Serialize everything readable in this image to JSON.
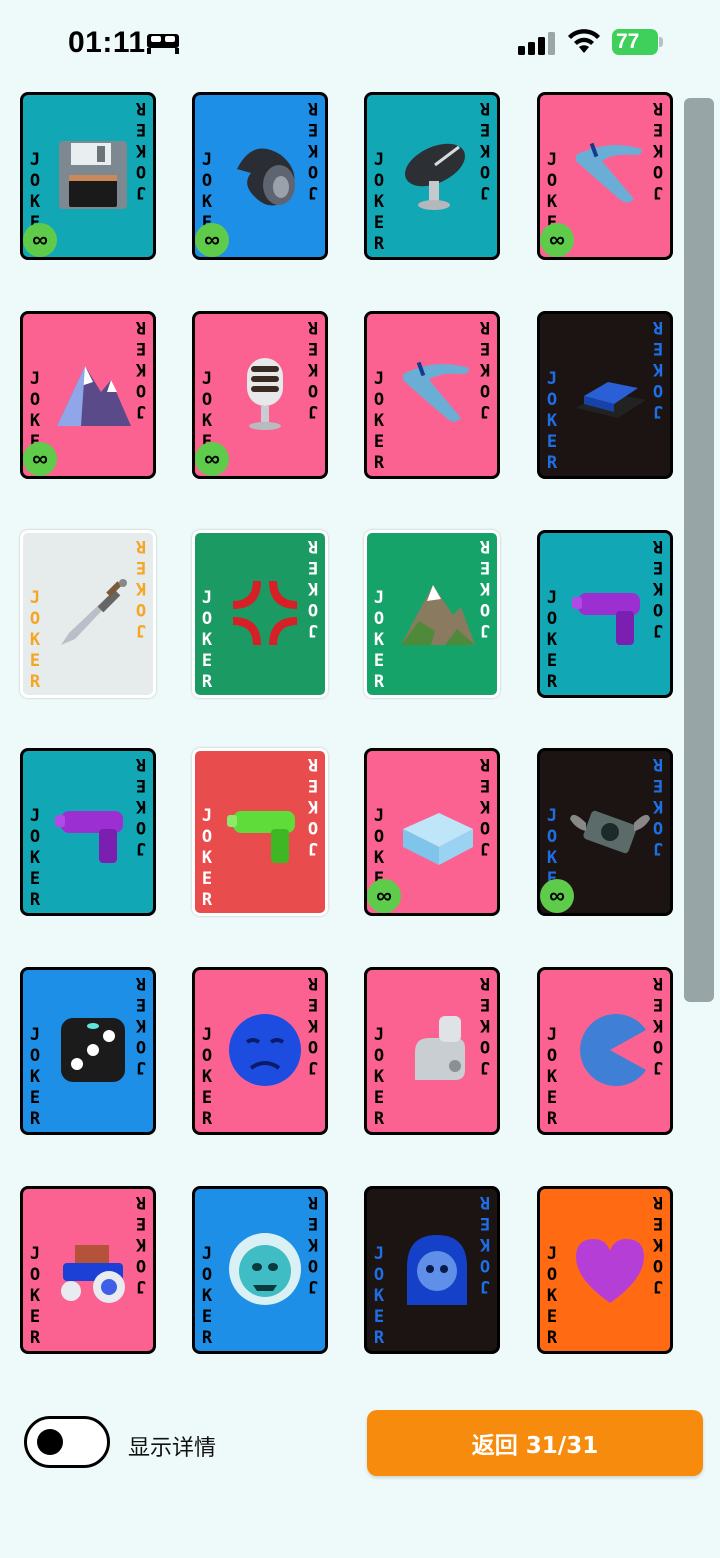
{
  "status_bar": {
    "time": "01:11",
    "battery_level": "77"
  },
  "joker_text": [
    "J",
    "O",
    "K",
    "E",
    "R"
  ],
  "infinity_symbol": "∞",
  "cards": [
    {
      "bg": "#12a7b5",
      "art": "floppy-disk",
      "letter_color": "#000",
      "infinite": true
    },
    {
      "bg": "#1e8fe6",
      "art": "spiral-shell",
      "letter_color": "#000",
      "infinite": true
    },
    {
      "bg": "#12a7b5",
      "art": "satellite-dish",
      "letter_color": "#000",
      "infinite": false
    },
    {
      "bg": "#fb6292",
      "art": "boomerang",
      "letter_color": "#000",
      "infinite": true
    },
    {
      "bg": "#fb6292",
      "art": "snow-mountain",
      "letter_color": "#000",
      "infinite": true
    },
    {
      "bg": "#fb6292",
      "art": "microphone",
      "letter_color": "#000",
      "infinite": true
    },
    {
      "bg": "#fb6292",
      "art": "boomerang",
      "letter_color": "#000",
      "infinite": false
    },
    {
      "bg": "#1b1412",
      "art": "butter",
      "letter_color": "#1e6fe6",
      "infinite": false
    },
    {
      "bg": "#e6ebec",
      "art": "dagger",
      "letter_color": "#f5a623",
      "infinite": false,
      "white_border": true
    },
    {
      "bg": "#1b9a63",
      "art": "anger-symbol",
      "letter_color": "#ffffff",
      "infinite": false,
      "white_border": true
    },
    {
      "bg": "#16a36a",
      "art": "mountain",
      "letter_color": "#ffffff",
      "infinite": false,
      "white_border": true
    },
    {
      "bg": "#12a7b5",
      "art": "water-pistol-purple",
      "letter_color": "#000",
      "infinite": false
    },
    {
      "bg": "#12a7b5",
      "art": "water-pistol-purple",
      "letter_color": "#000",
      "infinite": false
    },
    {
      "bg": "#e84c4c",
      "art": "water-pistol-green",
      "letter_color": "#ffffff",
      "infinite": false,
      "white_border": true
    },
    {
      "bg": "#fb6292",
      "art": "ice-cube",
      "letter_color": "#000",
      "infinite": true
    },
    {
      "bg": "#1b1412",
      "art": "money-wings",
      "letter_color": "#1e6fe6",
      "infinite": true
    },
    {
      "bg": "#1e8fe6",
      "art": "dice",
      "letter_color": "#000",
      "infinite": false
    },
    {
      "bg": "#fb6292",
      "art": "sad-face",
      "letter_color": "#000",
      "infinite": false
    },
    {
      "bg": "#fb6292",
      "art": "mechanical-arm",
      "letter_color": "#000",
      "infinite": false
    },
    {
      "bg": "#fb6292",
      "art": "pacman",
      "letter_color": "#000",
      "infinite": false
    },
    {
      "bg": "#fb6292",
      "art": "tractor",
      "letter_color": "#000",
      "infinite": false
    },
    {
      "bg": "#1e8fe6",
      "art": "ogre-mask",
      "letter_color": "#000",
      "infinite": false
    },
    {
      "bg": "#1b1412",
      "art": "ghost-face",
      "letter_color": "#1e6fe6",
      "infinite": false
    },
    {
      "bg": "#ff6a12",
      "art": "purple-heart",
      "letter_color": "#000",
      "infinite": false
    }
  ],
  "bottom": {
    "toggle_label": "显示详情",
    "back_button_label": "返回 31/31"
  }
}
